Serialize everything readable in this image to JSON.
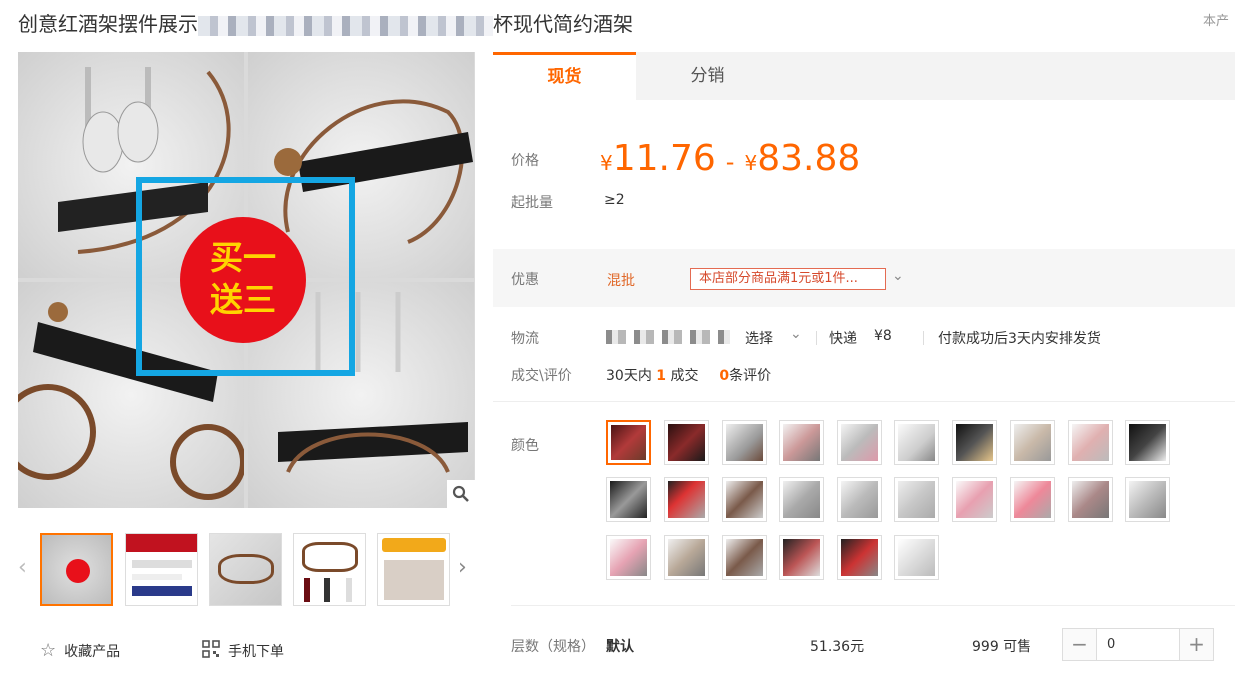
{
  "title_left": "创意红酒架摆件展示",
  "title_right": "杯现代简约酒架",
  "top_right": "本产",
  "image": {
    "badge_line1": "买一",
    "badge_line2": "送三"
  },
  "tabs": [
    {
      "label": "现货"
    },
    {
      "label": "分销"
    }
  ],
  "price": {
    "label": "价格",
    "currency": "¥",
    "low": "11.76",
    "high": "83.88",
    "separator": "-"
  },
  "moq": {
    "label": "起批量",
    "value": "≥2"
  },
  "promo": {
    "label": "优惠",
    "type": "混批",
    "tag": "本店部分商品满1元或1件..."
  },
  "logistics": {
    "label": "物流",
    "select": "选择",
    "method": "快递",
    "fee": "¥8",
    "note": "付款成功后3天内安排发货"
  },
  "deals": {
    "label": "成交\\评价",
    "prefix": "30天内",
    "count": "1",
    "count_suffix": "成交",
    "reviews": "0",
    "reviews_suffix": "条评价"
  },
  "color": {
    "label": "颜色"
  },
  "spec": {
    "label": "层数（规格）",
    "name": "默认",
    "price": "51.36元",
    "stock": "999 可售",
    "qty": "0"
  },
  "actions": {
    "favorite": "收藏产品",
    "mobile": "手机下单"
  },
  "colors": {
    "accent": "#ff6600",
    "badge_red": "#e8101a",
    "frame_blue": "#14a6e3"
  }
}
